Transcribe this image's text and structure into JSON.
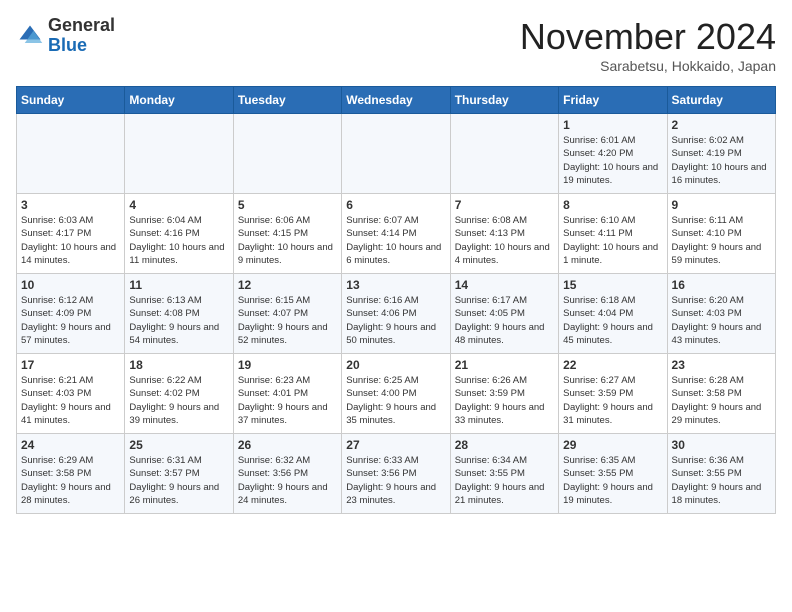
{
  "logo": {
    "general": "General",
    "blue": "Blue"
  },
  "title": "November 2024",
  "location": "Sarabetsu, Hokkaido, Japan",
  "days_of_week": [
    "Sunday",
    "Monday",
    "Tuesday",
    "Wednesday",
    "Thursday",
    "Friday",
    "Saturday"
  ],
  "weeks": [
    [
      {
        "day": "",
        "info": ""
      },
      {
        "day": "",
        "info": ""
      },
      {
        "day": "",
        "info": ""
      },
      {
        "day": "",
        "info": ""
      },
      {
        "day": "",
        "info": ""
      },
      {
        "day": "1",
        "info": "Sunrise: 6:01 AM\nSunset: 4:20 PM\nDaylight: 10 hours and 19 minutes."
      },
      {
        "day": "2",
        "info": "Sunrise: 6:02 AM\nSunset: 4:19 PM\nDaylight: 10 hours and 16 minutes."
      }
    ],
    [
      {
        "day": "3",
        "info": "Sunrise: 6:03 AM\nSunset: 4:17 PM\nDaylight: 10 hours and 14 minutes."
      },
      {
        "day": "4",
        "info": "Sunrise: 6:04 AM\nSunset: 4:16 PM\nDaylight: 10 hours and 11 minutes."
      },
      {
        "day": "5",
        "info": "Sunrise: 6:06 AM\nSunset: 4:15 PM\nDaylight: 10 hours and 9 minutes."
      },
      {
        "day": "6",
        "info": "Sunrise: 6:07 AM\nSunset: 4:14 PM\nDaylight: 10 hours and 6 minutes."
      },
      {
        "day": "7",
        "info": "Sunrise: 6:08 AM\nSunset: 4:13 PM\nDaylight: 10 hours and 4 minutes."
      },
      {
        "day": "8",
        "info": "Sunrise: 6:10 AM\nSunset: 4:11 PM\nDaylight: 10 hours and 1 minute."
      },
      {
        "day": "9",
        "info": "Sunrise: 6:11 AM\nSunset: 4:10 PM\nDaylight: 9 hours and 59 minutes."
      }
    ],
    [
      {
        "day": "10",
        "info": "Sunrise: 6:12 AM\nSunset: 4:09 PM\nDaylight: 9 hours and 57 minutes."
      },
      {
        "day": "11",
        "info": "Sunrise: 6:13 AM\nSunset: 4:08 PM\nDaylight: 9 hours and 54 minutes."
      },
      {
        "day": "12",
        "info": "Sunrise: 6:15 AM\nSunset: 4:07 PM\nDaylight: 9 hours and 52 minutes."
      },
      {
        "day": "13",
        "info": "Sunrise: 6:16 AM\nSunset: 4:06 PM\nDaylight: 9 hours and 50 minutes."
      },
      {
        "day": "14",
        "info": "Sunrise: 6:17 AM\nSunset: 4:05 PM\nDaylight: 9 hours and 48 minutes."
      },
      {
        "day": "15",
        "info": "Sunrise: 6:18 AM\nSunset: 4:04 PM\nDaylight: 9 hours and 45 minutes."
      },
      {
        "day": "16",
        "info": "Sunrise: 6:20 AM\nSunset: 4:03 PM\nDaylight: 9 hours and 43 minutes."
      }
    ],
    [
      {
        "day": "17",
        "info": "Sunrise: 6:21 AM\nSunset: 4:03 PM\nDaylight: 9 hours and 41 minutes."
      },
      {
        "day": "18",
        "info": "Sunrise: 6:22 AM\nSunset: 4:02 PM\nDaylight: 9 hours and 39 minutes."
      },
      {
        "day": "19",
        "info": "Sunrise: 6:23 AM\nSunset: 4:01 PM\nDaylight: 9 hours and 37 minutes."
      },
      {
        "day": "20",
        "info": "Sunrise: 6:25 AM\nSunset: 4:00 PM\nDaylight: 9 hours and 35 minutes."
      },
      {
        "day": "21",
        "info": "Sunrise: 6:26 AM\nSunset: 3:59 PM\nDaylight: 9 hours and 33 minutes."
      },
      {
        "day": "22",
        "info": "Sunrise: 6:27 AM\nSunset: 3:59 PM\nDaylight: 9 hours and 31 minutes."
      },
      {
        "day": "23",
        "info": "Sunrise: 6:28 AM\nSunset: 3:58 PM\nDaylight: 9 hours and 29 minutes."
      }
    ],
    [
      {
        "day": "24",
        "info": "Sunrise: 6:29 AM\nSunset: 3:58 PM\nDaylight: 9 hours and 28 minutes."
      },
      {
        "day": "25",
        "info": "Sunrise: 6:31 AM\nSunset: 3:57 PM\nDaylight: 9 hours and 26 minutes."
      },
      {
        "day": "26",
        "info": "Sunrise: 6:32 AM\nSunset: 3:56 PM\nDaylight: 9 hours and 24 minutes."
      },
      {
        "day": "27",
        "info": "Sunrise: 6:33 AM\nSunset: 3:56 PM\nDaylight: 9 hours and 23 minutes."
      },
      {
        "day": "28",
        "info": "Sunrise: 6:34 AM\nSunset: 3:55 PM\nDaylight: 9 hours and 21 minutes."
      },
      {
        "day": "29",
        "info": "Sunrise: 6:35 AM\nSunset: 3:55 PM\nDaylight: 9 hours and 19 minutes."
      },
      {
        "day": "30",
        "info": "Sunrise: 6:36 AM\nSunset: 3:55 PM\nDaylight: 9 hours and 18 minutes."
      }
    ]
  ]
}
